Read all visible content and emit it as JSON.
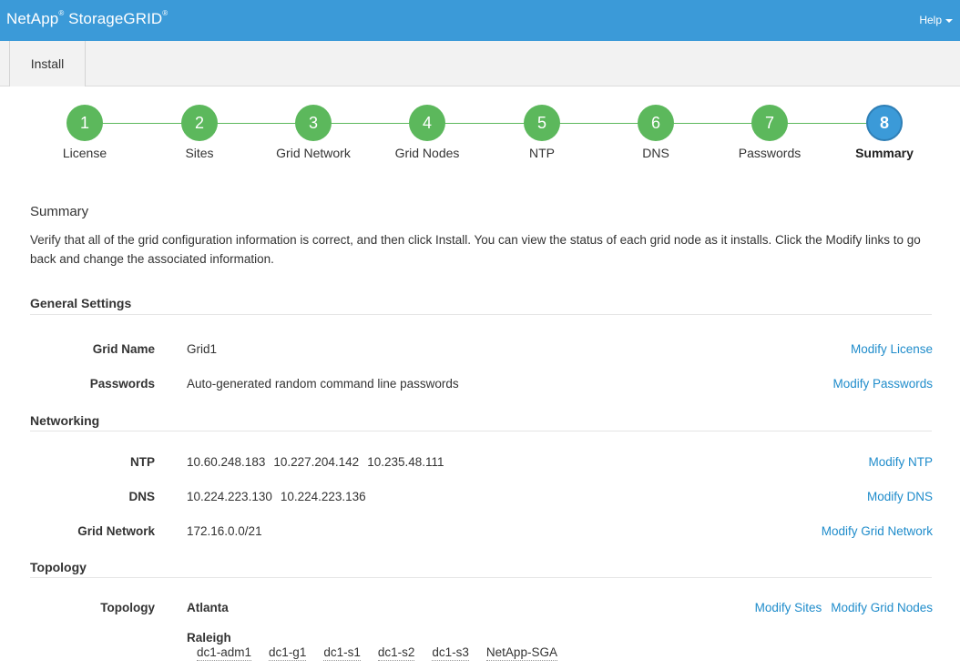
{
  "header": {
    "brand": "NetApp",
    "product": "StorageGRID",
    "reg_mark": "®",
    "help_label": "Help"
  },
  "tabs": [
    {
      "label": "Install"
    }
  ],
  "steps": [
    {
      "number": "1",
      "label": "License",
      "state": "done"
    },
    {
      "number": "2",
      "label": "Sites",
      "state": "done"
    },
    {
      "number": "3",
      "label": "Grid Network",
      "state": "done"
    },
    {
      "number": "4",
      "label": "Grid Nodes",
      "state": "done"
    },
    {
      "number": "5",
      "label": "NTP",
      "state": "done"
    },
    {
      "number": "6",
      "label": "DNS",
      "state": "done"
    },
    {
      "number": "7",
      "label": "Passwords",
      "state": "done"
    },
    {
      "number": "8",
      "label": "Summary",
      "state": "active"
    }
  ],
  "summary": {
    "heading": "Summary",
    "intro": "Verify that all of the grid configuration information is correct, and then click Install. You can view the status of each grid node as it installs. Click the Modify links to go back and change the associated information."
  },
  "general": {
    "title": "General Settings",
    "grid_name_label": "Grid Name",
    "grid_name_value": "Grid1",
    "grid_name_link": "Modify License",
    "passwords_label": "Passwords",
    "passwords_value": "Auto-generated random command line passwords",
    "passwords_link": "Modify Passwords"
  },
  "networking": {
    "title": "Networking",
    "ntp_label": "NTP",
    "ntp_values": [
      "10.60.248.183",
      "10.227.204.142",
      "10.235.48.111"
    ],
    "ntp_link": "Modify NTP",
    "dns_label": "DNS",
    "dns_values": [
      "10.224.223.130",
      "10.224.223.136"
    ],
    "dns_link": "Modify DNS",
    "grid_network_label": "Grid Network",
    "grid_network_value": "172.16.0.0/21",
    "grid_network_link": "Modify Grid Network"
  },
  "topology": {
    "title": "Topology",
    "label": "Topology",
    "sites": [
      {
        "name": "Atlanta",
        "nodes": []
      },
      {
        "name": "Raleigh",
        "nodes": [
          "dc1-adm1",
          "dc1-g1",
          "dc1-s1",
          "dc1-s2",
          "dc1-s3",
          "NetApp-SGA"
        ]
      }
    ],
    "modify_sites_link": "Modify Sites",
    "modify_nodes_link": "Modify Grid Nodes"
  },
  "colors": {
    "header_blue": "#3b9ad8",
    "step_done": "#5cb85c",
    "step_active": "#3b9ad8",
    "link": "#1f8ccb"
  }
}
